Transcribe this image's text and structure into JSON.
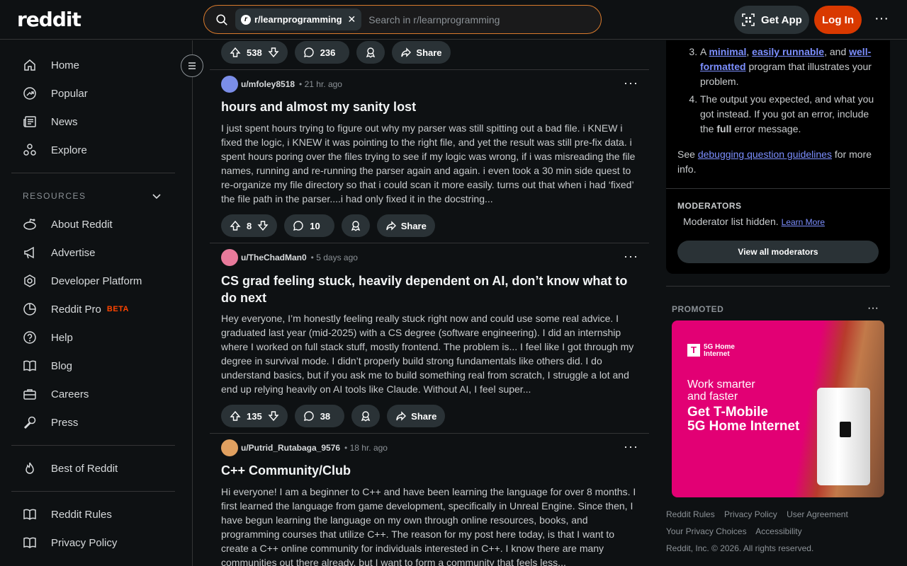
{
  "header": {
    "logo_text": "reddit",
    "search_chip": "r/learnprogramming",
    "search_placeholder": "Search in r/learnprogramming",
    "get_app": "Get App",
    "login": "Log In",
    "more": "···"
  },
  "sidebar": {
    "top": [
      {
        "label": "Home",
        "icon": "home-icon"
      },
      {
        "label": "Popular",
        "icon": "popular-icon"
      },
      {
        "label": "News",
        "icon": "news-icon"
      },
      {
        "label": "Explore",
        "icon": "explore-icon"
      }
    ],
    "resources_label": "RESOURCES",
    "resources": [
      {
        "label": "About Reddit",
        "icon": "alien-icon"
      },
      {
        "label": "Advertise",
        "icon": "megaphone-icon"
      },
      {
        "label": "Developer Platform",
        "icon": "hexagon-icon"
      },
      {
        "label": "Reddit Pro",
        "icon": "pie-icon",
        "badge": "BETA"
      },
      {
        "label": "Help",
        "icon": "help-icon"
      },
      {
        "label": "Blog",
        "icon": "book-icon"
      },
      {
        "label": "Careers",
        "icon": "briefcase-icon"
      },
      {
        "label": "Press",
        "icon": "microphone-icon"
      }
    ],
    "best": {
      "label": "Best of Reddit",
      "icon": "flame-icon"
    },
    "bottom": [
      {
        "label": "Reddit Rules",
        "icon": "book-icon"
      },
      {
        "label": "Privacy Policy",
        "icon": "book-icon"
      }
    ]
  },
  "feed": {
    "first_bar": {
      "votes": "538",
      "comments": "236",
      "share": "Share"
    },
    "posts": [
      {
        "user": "u/mfoley8518",
        "time": "21 hr. ago",
        "avatar_color": "#7b8ee8",
        "title": "hours and almost my sanity lost",
        "body": "I just spent hours trying to figure out why my parser was still spitting out a bad file. i KNEW i fixed the logic, i KNEW it was pointing to the right file, and yet the result was still pre-fix data. i spent hours poring over the files trying to see if my logic was wrong, if i was misreading the file names, running and re-running the parser again and again. i even took a 30 min side quest to re-organize my file directory so that i could scan it more easily. turns out that when i had ‘fixed’ the file path in the parser....i had only fixed it in the docstring...",
        "votes": "8",
        "comments": "10",
        "share": "Share"
      },
      {
        "user": "u/TheChadMan0",
        "time": "5 days ago",
        "avatar_color": "#e87a9b",
        "title": "CS grad feeling stuck, heavily dependent on AI, don’t know what to do next",
        "body": "Hey everyone, I’m honestly feeling really stuck right now and could use some real advice. I graduated last year (mid-2025) with a CS degree (software engineering). I did an internship where I worked on full stack stuff, mostly frontend. The problem is... I feel like I got through my degree in survival mode. I didn’t properly build strong fundamentals like others did. I do understand basics, but if you ask me to build something real from scratch, I struggle a lot and end up relying heavily on AI tools like Claude. Without AI, I feel super...",
        "votes": "135",
        "comments": "38",
        "share": "Share"
      },
      {
        "user": "u/Putrid_Rutabaga_9576",
        "time": "18 hr. ago",
        "avatar_color": "#e0a060",
        "title": "C++ Community/Club",
        "body": "Hi everyone! I am a beginner to C++ and have been learning the language for over 8 months. I first learned the language from game development, specifically in Unreal Engine. Since then, I have begun learning the language on my own through online resources, books, and programming courses that utilize C++. The reason for my post here today, is that I want to create a C++ online community for individuals interested in C++. I know there are many communities out there already, but I want to form a community that feels less..."
      }
    ]
  },
  "right": {
    "rule3_prefix": "A ",
    "rule3_link1": "minimal",
    "rule3_comma": ", ",
    "rule3_link2": "easily runnable",
    "rule3_and": ", and ",
    "rule3_link3": "well-formatted",
    "rule3_suffix": " program that illustrates your problem.",
    "rule4": "The output you expected, and what you got instead. If you got an error, include the ",
    "rule4_bold": "full",
    "rule4_end": " error message.",
    "see_prefix": "See ",
    "see_link": "debugging question guidelines",
    "see_suffix": " for more info.",
    "moderators_label": "MODERATORS",
    "moderator_hidden": "Moderator list hidden.",
    "learn_more": "Learn More",
    "view_all": "View all moderators",
    "promoted_label": "PROMOTED",
    "ad": {
      "brand_mark": "T",
      "brand_line1": "5G Home",
      "brand_line2": "Internet",
      "line1": "Work smarter",
      "line2": "and faster",
      "headline1": "Get T-Mobile",
      "headline2": "5G Home Internet"
    },
    "footer_row1": [
      "Reddit Rules",
      "Privacy Policy",
      "User Agreement"
    ],
    "footer_row2": [
      "Your Privacy Choices",
      "Accessibility"
    ],
    "copyright": "Reddit, Inc. © 2026. All rights reserved."
  }
}
